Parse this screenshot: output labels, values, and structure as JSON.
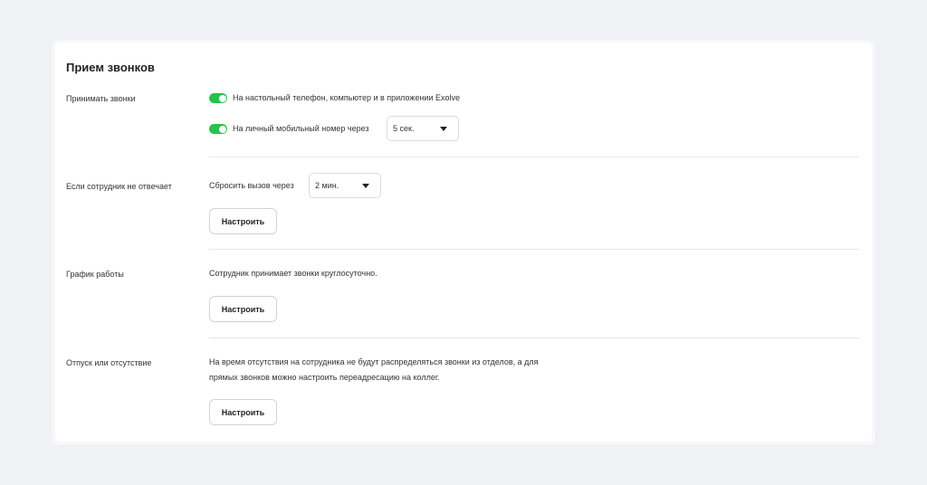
{
  "section_title": "Прием звонков",
  "receive_calls": {
    "label": "Принимать звонки",
    "option_desk": "На настольный телефон, компьютер и в приложении Exolve",
    "option_mobile": "На личный мобильный номер через",
    "mobile_delay": "5 сек."
  },
  "no_answer": {
    "label": "Если сотрудник не отвечает",
    "reset_text": "Сбросить вызов через",
    "reset_delay": "2 мин.",
    "configure": "Настроить"
  },
  "schedule": {
    "label": "График работы",
    "text": "Сотрудник принимает звонки круглосуточно.",
    "configure": "Настроить"
  },
  "vacation": {
    "label": "Отпуск или отсутствие",
    "text_line1": "На время отсутствия на сотрудника не будут распределяться звонки из отделов, а для",
    "text_line2": "прямых звонков можно настроить переадресацию на коллег.",
    "configure": "Настроить"
  },
  "colors": {
    "toggle_on": "#27c24c",
    "background": "#f1f2f5"
  }
}
